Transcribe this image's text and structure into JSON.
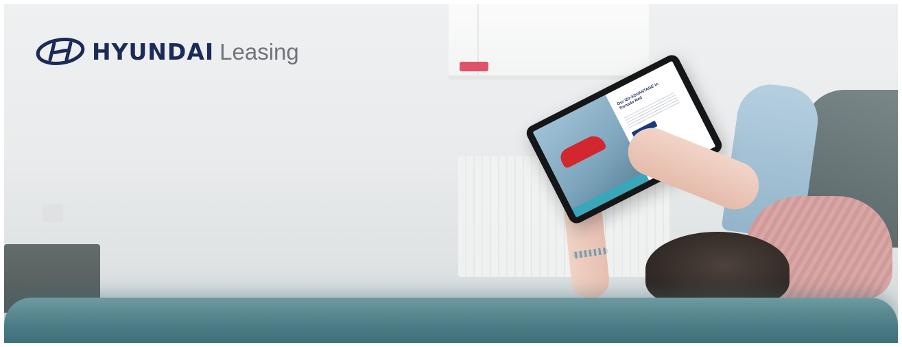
{
  "brand": {
    "name": "HYUNDAI",
    "sub": "Leasing",
    "logo_icon": "hyundai-emblem-icon",
    "color_primary": "#1b2a57",
    "color_secondary": "#6f747a"
  },
  "hero": {
    "tablet_screen_heading": "Our i20-ADVANTAGE in Tornado Red"
  }
}
